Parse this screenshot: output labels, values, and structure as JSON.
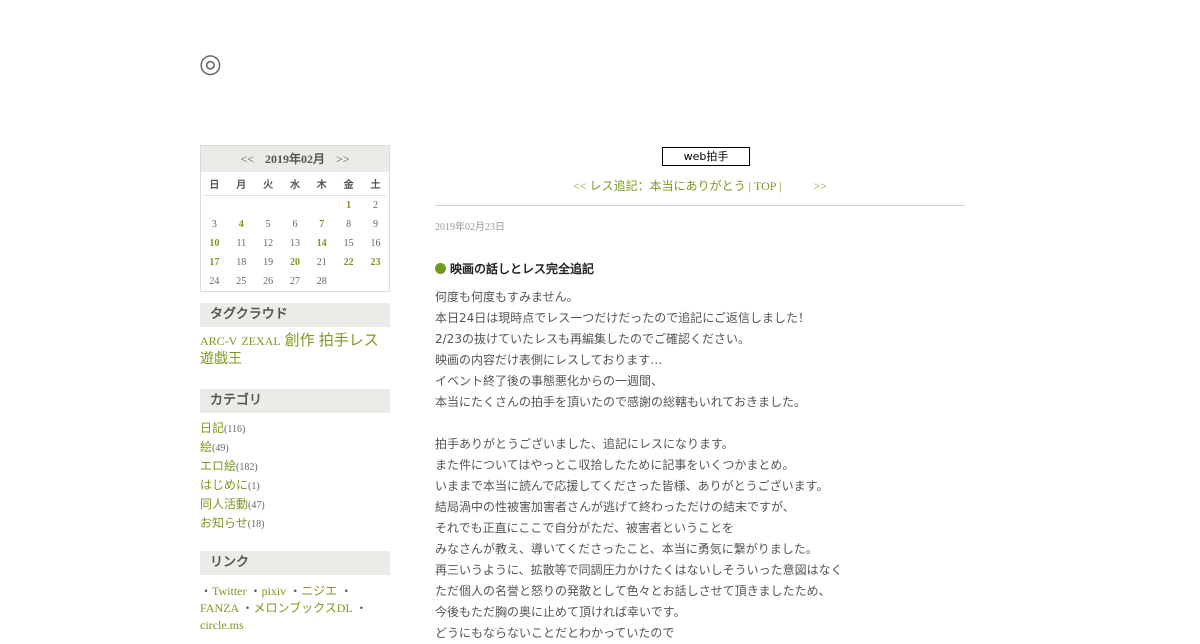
{
  "site": {
    "title": "◎"
  },
  "calendar": {
    "prev": "<<",
    "month": "2019年02月",
    "next": ">>",
    "weekdays": [
      "日",
      "月",
      "火",
      "水",
      "木",
      "金",
      "土"
    ],
    "weeks": [
      [
        "",
        "",
        "",
        "",
        "",
        "1",
        "2"
      ],
      [
        "3",
        "4",
        "5",
        "6",
        "7",
        "8",
        "9"
      ],
      [
        "10",
        "11",
        "12",
        "13",
        "14",
        "15",
        "16"
      ],
      [
        "17",
        "18",
        "19",
        "20",
        "21",
        "22",
        "23"
      ],
      [
        "24",
        "25",
        "26",
        "27",
        "28",
        "",
        ""
      ]
    ],
    "linked": [
      "1",
      "4",
      "7",
      "10",
      "14",
      "17",
      "20",
      "22",
      "23"
    ]
  },
  "tagcloud": {
    "heading": "タグクラウド",
    "tags": [
      {
        "label": "ARC-V",
        "size": "t12"
      },
      {
        "label": "ZEXAL",
        "size": "t12"
      },
      {
        "label": "創作",
        "size": "t15"
      },
      {
        "label": "拍手レス",
        "size": "t15"
      },
      {
        "label": "遊戯王",
        "size": "t14"
      }
    ]
  },
  "category": {
    "heading": "カテゴリ",
    "items": [
      {
        "name": "日記",
        "count": "(116)"
      },
      {
        "name": "絵",
        "count": "(49)"
      },
      {
        "name": "エロ絵",
        "count": "(182)"
      },
      {
        "name": "はじめに",
        "count": "(1)"
      },
      {
        "name": "同人活動",
        "count": "(47)"
      },
      {
        "name": "お知らせ",
        "count": "(18)"
      }
    ]
  },
  "links": {
    "heading": "リンク",
    "bullet": "・",
    "items": [
      "Twitter",
      "pixiv",
      "ニジエ",
      "FANZA",
      "メロンブックスDL",
      "circle.ms"
    ]
  },
  "main": {
    "clap_label": "web拍手",
    "pager": {
      "prev": "<< レス追記：本当にありがとう",
      "sep1": "|",
      "top": "TOP",
      "sep2": "|",
      "next": ">>"
    },
    "date": "2019年02月23日",
    "title": "映画の話しとレス完全追記",
    "lines": [
      "何度も何度もすみません。",
      "本日24日は現時点でレス一つだけだったので追記にご返信しました！",
      "2/23の抜けていたレスも再編集したのでご確認ください。",
      "映画の内容だけ表側にレスしております…",
      "イベント終了後の事態悪化からの一週間、",
      "本当にたくさんの拍手を頂いたので感謝の総轄もいれておきました。",
      "",
      "拍手ありがとうございました、追記にレスになります。",
      "また件についてはやっとこ収拾したために記事をいくつかまとめ。",
      "いままで本当に読んで応援してくださった皆様、ありがとうございます。",
      "結局渦中の性被害加害者さんが逃げて終わっただけの結末ですが、",
      "それでも正直にここで自分がただ、被害者ということを",
      "みなさんが教え、導いてくださったこと、本当に勇気に繋がりました。",
      "再三いうように、拡散等で同調圧力かけたくはないしそういった意図はなく",
      "ただ個人の名誉と怒りの発散として色々とお話しさせて頂きましたため、",
      "今後もただ胸の奥に止めて頂ければ幸いです。",
      "どうにもならないことだとわかっていたので"
    ]
  }
}
